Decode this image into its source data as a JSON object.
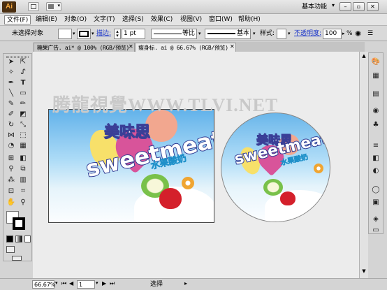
{
  "app": {
    "logo": "Ai",
    "workspace": "基本功能"
  },
  "menus": [
    "文件(F)",
    "编辑(E)",
    "对象(O)",
    "文字(T)",
    "选择(S)",
    "效果(C)",
    "视图(V)",
    "窗口(W)",
    "帮助(H)"
  ],
  "control": {
    "selection": "未选择对象",
    "stroke_label": "描边:",
    "stroke_weight": "1 pt",
    "profile": "等比",
    "brush": "基本",
    "style_label": "样式:",
    "opacity_label": "不透明度:",
    "opacity": "100",
    "percent": "%"
  },
  "tabs": [
    {
      "label": "糖果广告. ai* @ 100% (RGB/预览)"
    },
    {
      "label": "瘦身标. ai @ 66.67% (RGB/预览)"
    }
  ],
  "artwork": {
    "brand_cn": "美味思",
    "brand_en": "sweetmeat",
    "flavor": "水果酸奶"
  },
  "watermark": "腾龍視覺WWW.TLVI.NET",
  "status": {
    "zoom": "66.67%",
    "page": "1",
    "tool": "选择"
  },
  "colors": {
    "brand_blue": "#2f3a93",
    "sky": "#62b2ea",
    "link": "#1833c9"
  }
}
